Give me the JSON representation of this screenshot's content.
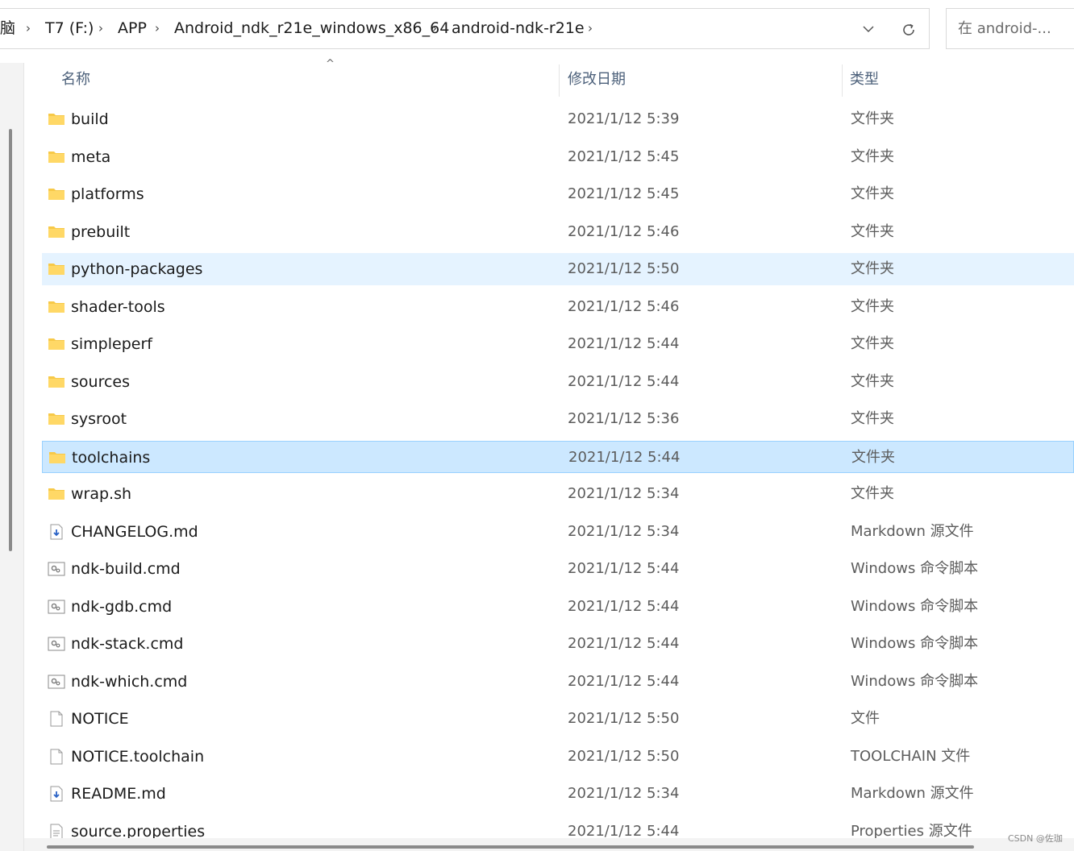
{
  "breadcrumb": {
    "items": [
      "脑",
      "T7 (F:)",
      "APP",
      "Android_ndk_r21e_windows_x86_64",
      "android-ndk-r21e"
    ],
    "separator": "›"
  },
  "search": {
    "placeholder": "在 android-..."
  },
  "columns": {
    "name": "名称",
    "date": "修改日期",
    "type": "类型"
  },
  "files": [
    {
      "name": "build",
      "date": "2021/1/12 5:39",
      "type": "文件夹",
      "icon": "folder-icon"
    },
    {
      "name": "meta",
      "date": "2021/1/12 5:45",
      "type": "文件夹",
      "icon": "folder-icon"
    },
    {
      "name": "platforms",
      "date": "2021/1/12 5:45",
      "type": "文件夹",
      "icon": "folder-icon"
    },
    {
      "name": "prebuilt",
      "date": "2021/1/12 5:46",
      "type": "文件夹",
      "icon": "folder-icon"
    },
    {
      "name": "python-packages",
      "date": "2021/1/12 5:50",
      "type": "文件夹",
      "icon": "folder-icon",
      "state": "hover"
    },
    {
      "name": "shader-tools",
      "date": "2021/1/12 5:46",
      "type": "文件夹",
      "icon": "folder-icon"
    },
    {
      "name": "simpleperf",
      "date": "2021/1/12 5:44",
      "type": "文件夹",
      "icon": "folder-icon"
    },
    {
      "name": "sources",
      "date": "2021/1/12 5:44",
      "type": "文件夹",
      "icon": "folder-icon"
    },
    {
      "name": "sysroot",
      "date": "2021/1/12 5:36",
      "type": "文件夹",
      "icon": "folder-icon"
    },
    {
      "name": "toolchains",
      "date": "2021/1/12 5:44",
      "type": "文件夹",
      "icon": "folder-icon",
      "state": "selected"
    },
    {
      "name": "wrap.sh",
      "date": "2021/1/12 5:34",
      "type": "文件夹",
      "icon": "folder-icon"
    },
    {
      "name": "CHANGELOG.md",
      "date": "2021/1/12 5:34",
      "type": "Markdown 源文件",
      "icon": "markdown-file-icon"
    },
    {
      "name": "ndk-build.cmd",
      "date": "2021/1/12 5:44",
      "type": "Windows 命令脚本",
      "icon": "cmd-script-icon"
    },
    {
      "name": "ndk-gdb.cmd",
      "date": "2021/1/12 5:44",
      "type": "Windows 命令脚本",
      "icon": "cmd-script-icon"
    },
    {
      "name": "ndk-stack.cmd",
      "date": "2021/1/12 5:44",
      "type": "Windows 命令脚本",
      "icon": "cmd-script-icon"
    },
    {
      "name": "ndk-which.cmd",
      "date": "2021/1/12 5:44",
      "type": "Windows 命令脚本",
      "icon": "cmd-script-icon"
    },
    {
      "name": "NOTICE",
      "date": "2021/1/12 5:50",
      "type": "文件",
      "icon": "blank-file-icon"
    },
    {
      "name": "NOTICE.toolchain",
      "date": "2021/1/12 5:50",
      "type": "TOOLCHAIN 文件",
      "icon": "blank-file-icon"
    },
    {
      "name": "README.md",
      "date": "2021/1/12 5:34",
      "type": "Markdown 源文件",
      "icon": "markdown-file-icon"
    },
    {
      "name": "source.properties",
      "date": "2021/1/12 5:44",
      "type": "Properties 源文件",
      "icon": "properties-file-icon"
    }
  ],
  "watermark": "CSDN @佐珈",
  "colors": {
    "selected": "#cce8ff",
    "hover": "#e5f3ff",
    "folder": "#f7c948",
    "header_text": "#4c607a"
  }
}
